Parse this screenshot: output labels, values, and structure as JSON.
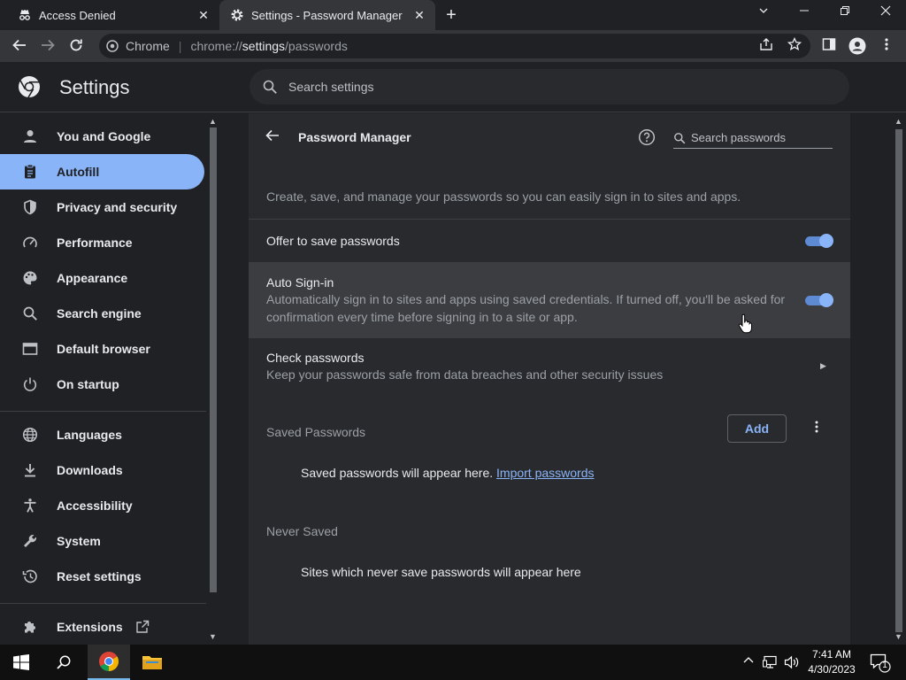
{
  "tabs": [
    {
      "title": "Access Denied",
      "icon": "incognito-icon"
    },
    {
      "title": "Settings - Password Manager",
      "icon": "gear-icon"
    }
  ],
  "omnibox": {
    "site": "Chrome",
    "url_prefix": "chrome://",
    "url_host": "settings",
    "url_path": "/passwords"
  },
  "header": {
    "title": "Settings",
    "search_placeholder": "Search settings"
  },
  "sidebar": {
    "items": [
      {
        "label": "You and Google",
        "icon": "person-icon"
      },
      {
        "label": "Autofill",
        "icon": "clipboard-icon",
        "active": true
      },
      {
        "label": "Privacy and security",
        "icon": "shield-icon"
      },
      {
        "label": "Performance",
        "icon": "speedometer-icon"
      },
      {
        "label": "Appearance",
        "icon": "palette-icon"
      },
      {
        "label": "Search engine",
        "icon": "search-icon"
      },
      {
        "label": "Default browser",
        "icon": "browser-icon"
      },
      {
        "label": "On startup",
        "icon": "power-icon"
      },
      {
        "label": "Languages",
        "icon": "globe-icon"
      },
      {
        "label": "Downloads",
        "icon": "download-icon"
      },
      {
        "label": "Accessibility",
        "icon": "accessibility-icon"
      },
      {
        "label": "System",
        "icon": "wrench-icon"
      },
      {
        "label": "Reset settings",
        "icon": "history-icon"
      },
      {
        "label": "Extensions",
        "icon": "puzzle-icon"
      }
    ]
  },
  "main": {
    "title": "Password Manager",
    "search_placeholder": "Search passwords",
    "description": "Create, save, and manage your passwords so you can easily sign in to sites and apps.",
    "offer_save": {
      "label": "Offer to save passwords",
      "enabled": true
    },
    "auto_signin": {
      "label": "Auto Sign-in",
      "sub_line1": "Automatically sign in to sites and apps using saved credentials. If turned off, you'll be asked for",
      "sub_line2": "confirmation every time before signing in to a site or app.",
      "enabled": true
    },
    "check": {
      "label": "Check passwords",
      "sub": "Keep your passwords safe from data breaches and other security issues"
    },
    "saved": {
      "title": "Saved Passwords",
      "add_label": "Add",
      "empty_text": "Saved passwords will appear here.",
      "import_link": "Import passwords"
    },
    "never": {
      "title": "Never Saved",
      "empty_text": "Sites which never save passwords will appear here"
    }
  },
  "taskbar": {
    "time": "7:41 AM",
    "date": "4/30/2023",
    "notification_count": "1"
  },
  "colors": {
    "accent": "#8ab4f8",
    "toggle_track": "#5e8ad4",
    "card": "#292a2d",
    "background": "#202124"
  }
}
